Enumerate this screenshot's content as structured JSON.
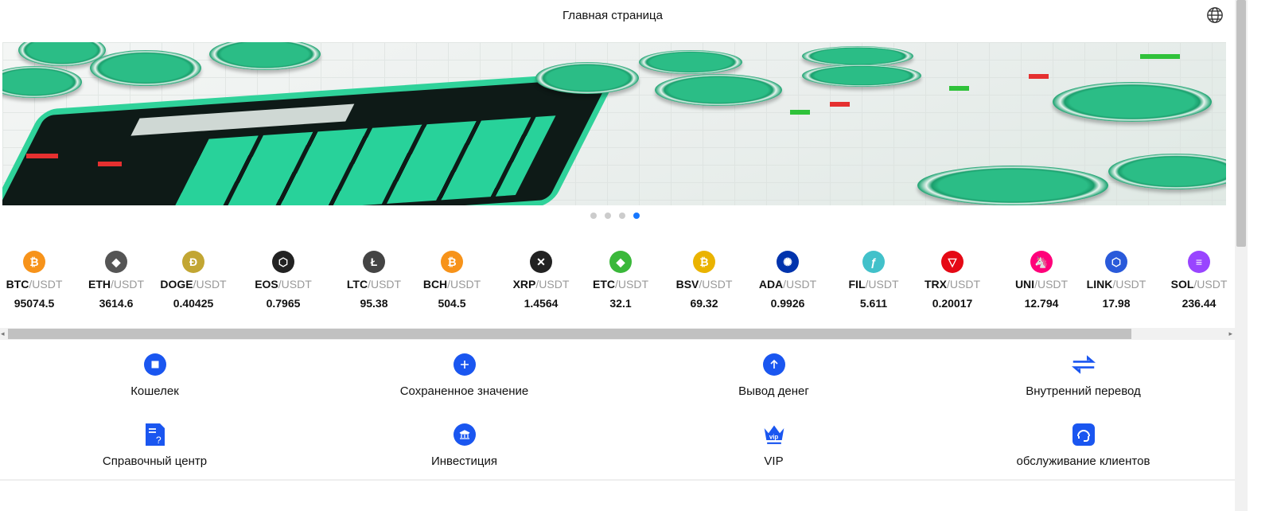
{
  "header": {
    "title": "Главная страница",
    "icon": "globe-icon"
  },
  "carousel": {
    "slides": 4,
    "active_index": 3
  },
  "coins": [
    {
      "base": "BTC",
      "quote": "/USDT",
      "price": "95074.5",
      "color": "#f7931a",
      "glyph": "₿"
    },
    {
      "base": "ETH",
      "quote": "/USDT",
      "price": "3614.6",
      "color": "#555",
      "glyph": "◆"
    },
    {
      "base": "DOGE",
      "quote": "/USDT",
      "price": "0.40425",
      "color": "#c2a633",
      "glyph": "Ð"
    },
    {
      "base": "EOS",
      "quote": "/USDT",
      "price": "0.7965",
      "color": "#222",
      "glyph": "⬡"
    },
    {
      "base": "LTC",
      "quote": "/USDT",
      "price": "95.38",
      "color": "#444",
      "glyph": "Ł"
    },
    {
      "base": "BCH",
      "quote": "/USDT",
      "price": "504.5",
      "color": "#f7931a",
      "glyph": "₿"
    },
    {
      "base": "XRP",
      "quote": "/USDT",
      "price": "1.4564",
      "color": "#222",
      "glyph": "✕"
    },
    {
      "base": "ETC",
      "quote": "/USDT",
      "price": "32.1",
      "color": "#3ab83a",
      "glyph": "◆"
    },
    {
      "base": "BSV",
      "quote": "/USDT",
      "price": "69.32",
      "color": "#eab300",
      "glyph": "₿"
    },
    {
      "base": "ADA",
      "quote": "/USDT",
      "price": "0.9926",
      "color": "#0033ad",
      "glyph": "✺"
    },
    {
      "base": "FIL",
      "quote": "/USDT",
      "price": "5.611",
      "color": "#42c1ca",
      "glyph": "ƒ"
    },
    {
      "base": "TRX",
      "quote": "/USDT",
      "price": "0.20017",
      "color": "#e50915",
      "glyph": "▽"
    },
    {
      "base": "UNI",
      "quote": "/USDT",
      "price": "12.794",
      "color": "#ff007a",
      "glyph": "🦄"
    },
    {
      "base": "LINK",
      "quote": "/USDT",
      "price": "17.98",
      "color": "#2a5ada",
      "glyph": "⬡"
    },
    {
      "base": "SOL",
      "quote": "/USDT",
      "price": "236.44",
      "color": "#9945ff",
      "glyph": "≡"
    }
  ],
  "menu": [
    {
      "label": "Кошелек",
      "icon": "wallet-icon"
    },
    {
      "label": "Сохраненное значение",
      "icon": "deposit-plus-icon"
    },
    {
      "label": "Вывод денег",
      "icon": "withdraw-arrow-up-icon"
    },
    {
      "label": "Внутренний перевод",
      "icon": "transfer-arrows-icon"
    },
    {
      "label": "Справочный центр",
      "icon": "help-document-icon"
    },
    {
      "label": "Инвестиция",
      "icon": "investment-bank-icon"
    },
    {
      "label": "VIP",
      "icon": "vip-crown-icon"
    },
    {
      "label": "обслуживание клиентов",
      "icon": "customer-service-headset-icon"
    }
  ],
  "accent": "#1a56f0"
}
